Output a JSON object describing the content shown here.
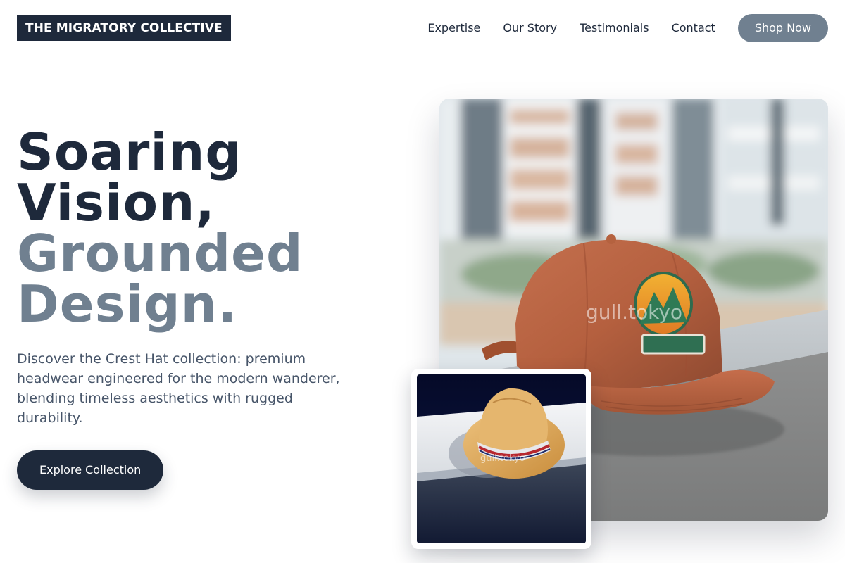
{
  "header": {
    "logo": "THE MIGRATORY COLLECTIVE",
    "nav": [
      "Expertise",
      "Our Story",
      "Testimonials",
      "Contact"
    ],
    "shop_button": "Shop Now"
  },
  "hero": {
    "headline_dark": [
      "Soaring",
      "Vision,"
    ],
    "headline_muted": [
      "Grounded",
      "Design."
    ],
    "description": "Discover the Crest Hat collection: premium headwear engineered for the modern wanderer, blending timeless aesthetics with rugged durability.",
    "cta": "Explore Collection",
    "main_image_watermark": "gull.tokyo",
    "small_image_watermark": "gull.tokyo"
  },
  "colors": {
    "dark": "#1e293b",
    "muted": "#708090",
    "body_text": "#475569"
  },
  "icons": {
    "main_image": "rust-baseball-cap-photo",
    "small_image": "straw-fedora-photo"
  }
}
